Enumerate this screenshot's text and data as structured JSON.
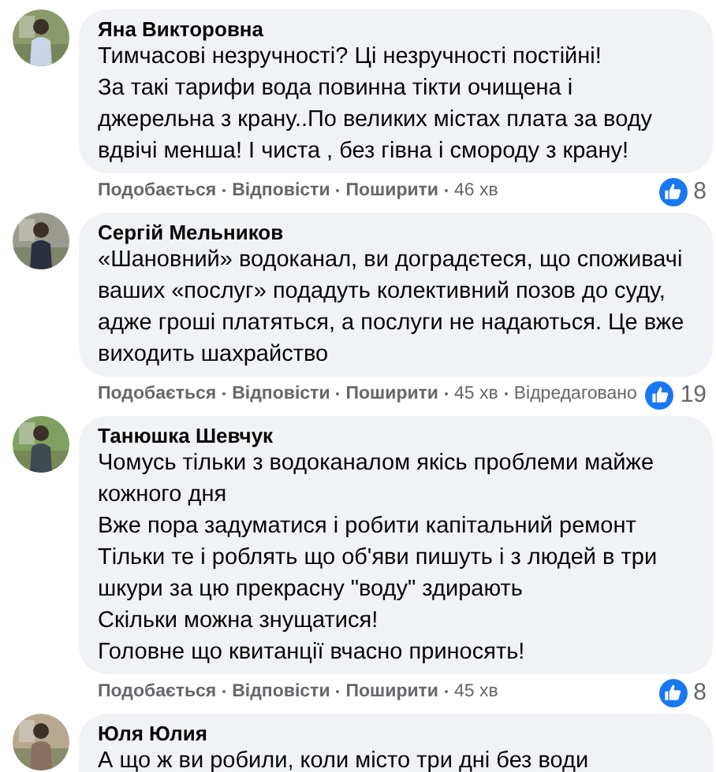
{
  "comments": [
    {
      "author": "Яна Викторовна",
      "lines": [
        "Тимчасові незручності? Ці незручності постійні!",
        "За такі тарифи вода повинна тікти очищена і",
        "джерельна з крану..По великих містах плата за воду",
        "вдвічі менша! І чиста , без гівна і смороду з крану!"
      ],
      "actions": [
        "Подобається",
        "Відповісти",
        "Поширити"
      ],
      "time": "46 хв",
      "reactions": "8"
    },
    {
      "author": "Сергій Мельников",
      "lines": [
        "«Шановний» водоканал, ви доградєтеся, що споживачі",
        "ваших «послуг» подадуть колективний позов до суду,",
        "адже гроші платяться, а послуги не надаються. Це вже",
        "виходить шахрайство"
      ],
      "actions": [
        "Подобається",
        "Відповісти",
        "Поширити"
      ],
      "time": "45 хв",
      "edited": "Відредаговано",
      "reactions": "19"
    },
    {
      "author": "Танюшка Шевчук",
      "lines": [
        "Чомусь тільки з водоканалом якісь проблеми майже",
        "кожного дня",
        "Вже пора задуматися і робити капітальний ремонт",
        "Тільки те і роблять що об'яви пишуть і з людей в три",
        "шкури за цю прекрасну \"воду\" здирають",
        "Скільки можна знущатися!",
        "Головне що квитанції вчасно приносять!"
      ],
      "actions": [
        "Подобається",
        "Відповісти",
        "Поширити"
      ],
      "time": "45 хв",
      "reactions": "8"
    },
    {
      "author": "Юля Юлия",
      "lines": [
        "А що ж ви робили, коли місто три дні без води"
      ]
    }
  ]
}
